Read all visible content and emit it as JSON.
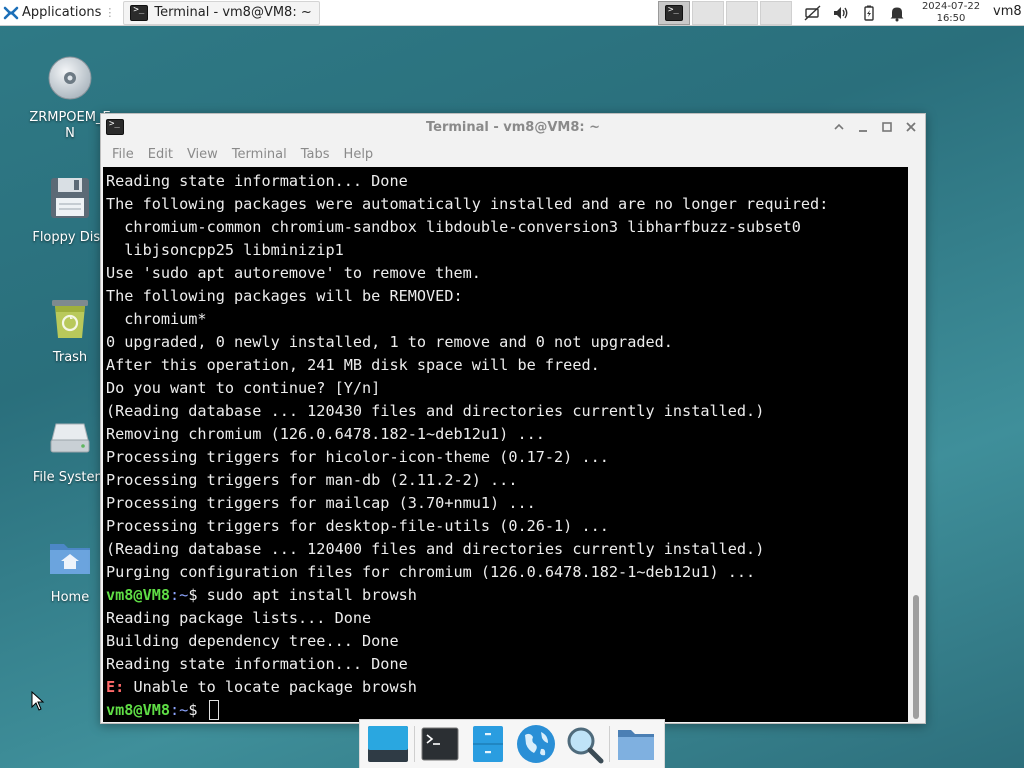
{
  "panel": {
    "applications_label": "Applications",
    "task_button_label": "Terminal - vm8@VM8: ~",
    "clock_date": "2024-07-22",
    "clock_time": "16:50",
    "user": "vm8"
  },
  "desktop": {
    "icons": [
      {
        "label": "ZRMPOEM_EN",
        "icon": "disc-icon"
      },
      {
        "label": "Floppy Disk",
        "icon": "floppy-icon"
      },
      {
        "label": "Trash",
        "icon": "trash-icon"
      },
      {
        "label": "File System",
        "icon": "drive-icon"
      },
      {
        "label": "Home",
        "icon": "home-folder-icon"
      }
    ]
  },
  "window": {
    "title": "Terminal - vm8@VM8: ~",
    "menu": [
      "File",
      "Edit",
      "View",
      "Terminal",
      "Tabs",
      "Help"
    ]
  },
  "terminal": {
    "prompt_user": "vm8@VM8",
    "prompt_path": ":~",
    "prompt_symbol": "$ ",
    "error_prefix": "E:",
    "lines": [
      {
        "kind": "out",
        "text": "Reading state information... Done"
      },
      {
        "kind": "out",
        "text": "The following packages were automatically installed and are no longer required:"
      },
      {
        "kind": "out",
        "text": "  chromium-common chromium-sandbox libdouble-conversion3 libharfbuzz-subset0"
      },
      {
        "kind": "out",
        "text": "  libjsoncpp25 libminizip1"
      },
      {
        "kind": "out",
        "text": "Use 'sudo apt autoremove' to remove them."
      },
      {
        "kind": "out",
        "text": "The following packages will be REMOVED:"
      },
      {
        "kind": "out",
        "text": "  chromium*"
      },
      {
        "kind": "out",
        "text": "0 upgraded, 0 newly installed, 1 to remove and 0 not upgraded."
      },
      {
        "kind": "out",
        "text": "After this operation, 241 MB disk space will be freed."
      },
      {
        "kind": "out",
        "text": "Do you want to continue? [Y/n]"
      },
      {
        "kind": "out",
        "text": "(Reading database ... 120430 files and directories currently installed.)"
      },
      {
        "kind": "out",
        "text": "Removing chromium (126.0.6478.182-1~deb12u1) ..."
      },
      {
        "kind": "out",
        "text": "Processing triggers for hicolor-icon-theme (0.17-2) ..."
      },
      {
        "kind": "out",
        "text": "Processing triggers for man-db (2.11.2-2) ..."
      },
      {
        "kind": "out",
        "text": "Processing triggers for mailcap (3.70+nmu1) ..."
      },
      {
        "kind": "out",
        "text": "Processing triggers for desktop-file-utils (0.26-1) ..."
      },
      {
        "kind": "out",
        "text": "(Reading database ... 120400 files and directories currently installed.)"
      },
      {
        "kind": "out",
        "text": "Purging configuration files for chromium (126.0.6478.182-1~deb12u1) ..."
      },
      {
        "kind": "cmd",
        "text": "sudo apt install browsh"
      },
      {
        "kind": "out",
        "text": "Reading package lists... Done"
      },
      {
        "kind": "out",
        "text": "Building dependency tree... Done"
      },
      {
        "kind": "out",
        "text": "Reading state information... Done"
      },
      {
        "kind": "err",
        "text": " Unable to locate package browsh"
      },
      {
        "kind": "prompt",
        "text": ""
      }
    ]
  },
  "dock": {
    "items": [
      "show-desktop-icon",
      "terminal-icon",
      "file-manager-icon",
      "web-browser-icon",
      "app-finder-icon",
      "home-folder-icon"
    ]
  }
}
